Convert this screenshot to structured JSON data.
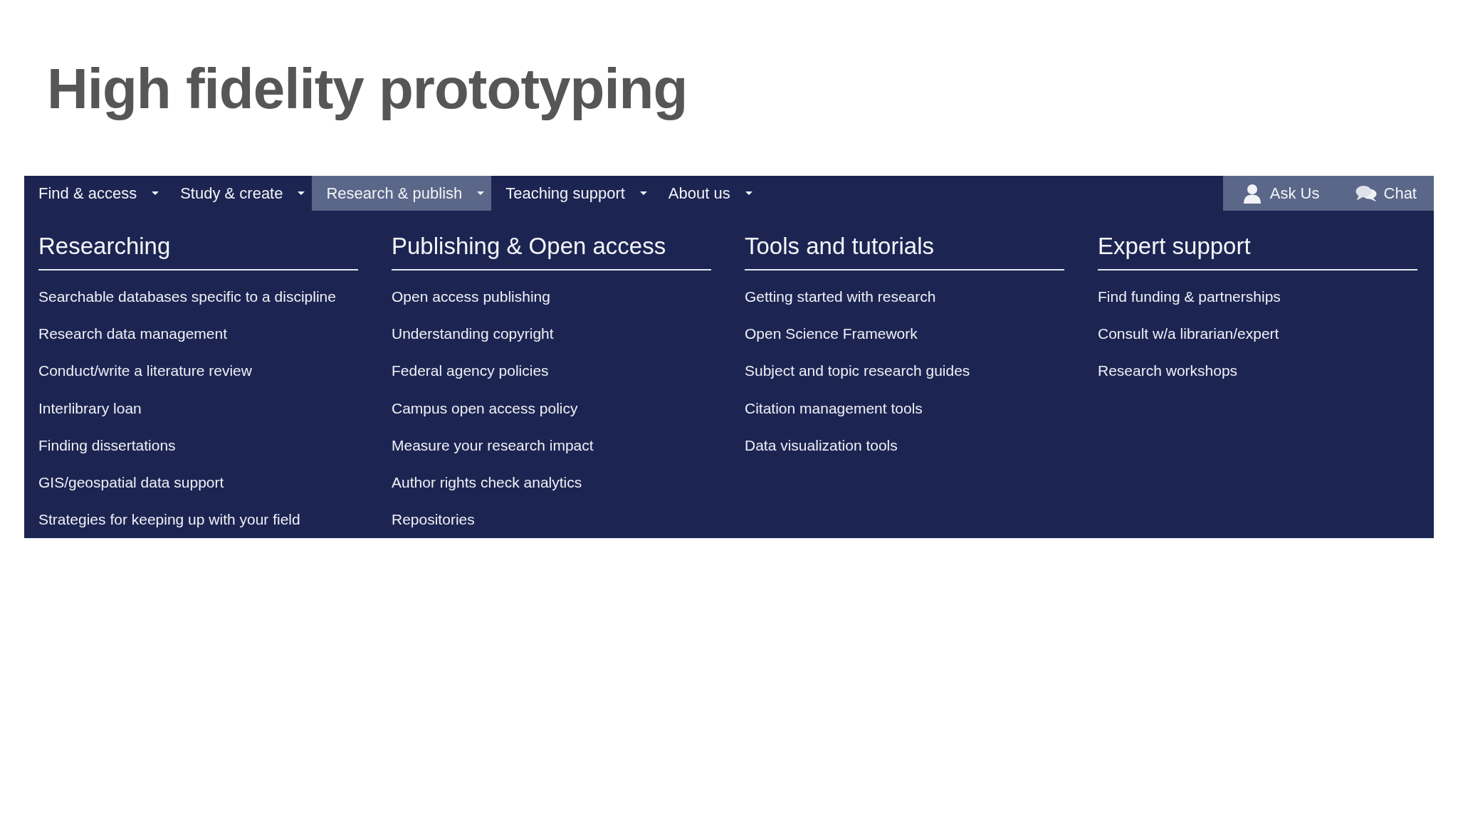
{
  "title": "High fidelity prototyping",
  "nav": {
    "tabs": [
      {
        "label": "Find & access",
        "selected": false
      },
      {
        "label": "Study & create",
        "selected": false
      },
      {
        "label": "Research & publish",
        "selected": true
      },
      {
        "label": "Teaching support",
        "selected": false
      },
      {
        "label": "About us",
        "selected": false
      }
    ],
    "actions": [
      {
        "label": "Ask Us",
        "kind": "person"
      },
      {
        "label": "Chat",
        "kind": "chat"
      }
    ]
  },
  "menu": {
    "columns": [
      {
        "heading": "Researching",
        "links": [
          "Searchable databases specific to a discipline",
          "Research data management",
          "Conduct/write a literature review",
          "Interlibrary loan",
          "Finding dissertations",
          "GIS/geospatial data support",
          "Strategies for keeping up with your field"
        ]
      },
      {
        "heading": "Publishing & Open access",
        "links": [
          "Open access publishing",
          "Understanding copyright",
          "Federal agency policies",
          "Campus open access policy",
          "Measure your research impact",
          "Author rights check analytics",
          "Repositories"
        ]
      },
      {
        "heading": "Tools and tutorials",
        "links": [
          "Getting started with research",
          "Open Science Framework",
          "Subject and topic research guides",
          "Citation management tools",
          "Data visualization tools"
        ]
      },
      {
        "heading": "Expert support",
        "links": [
          "Find funding & partnerships",
          "Consult w/a librarian/expert",
          "Research workshops"
        ]
      }
    ]
  }
}
